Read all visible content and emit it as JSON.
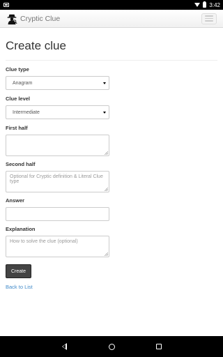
{
  "status_bar": {
    "time": "3:42",
    "icons": [
      "notification-icon",
      "wifi-icon",
      "battery-icon"
    ]
  },
  "navbar": {
    "brand": "Cryptic Clue",
    "logo_icon": "detective-icon",
    "menu_icon": "hamburger-menu-icon"
  },
  "page": {
    "title": "Create clue"
  },
  "form": {
    "clue_type": {
      "label": "Clue type",
      "value": "Anagram"
    },
    "clue_level": {
      "label": "Clue level",
      "value": "Intermediate"
    },
    "first_half": {
      "label": "First half",
      "placeholder": ""
    },
    "second_half": {
      "label": "Second half",
      "placeholder": "Optional for Cryptic definition & Literal Clue type"
    },
    "answer": {
      "label": "Answer",
      "value": ""
    },
    "explanation": {
      "label": "Explanation",
      "placeholder": "How to solve the clue (optional)"
    },
    "submit_label": "Create"
  },
  "links": {
    "back": "Back to List"
  },
  "nav_bar": {
    "icons": [
      "back-icon",
      "home-icon",
      "recents-icon"
    ]
  },
  "colors": {
    "link": "#428bca",
    "button": "#444444",
    "status_bar": "#000000"
  }
}
